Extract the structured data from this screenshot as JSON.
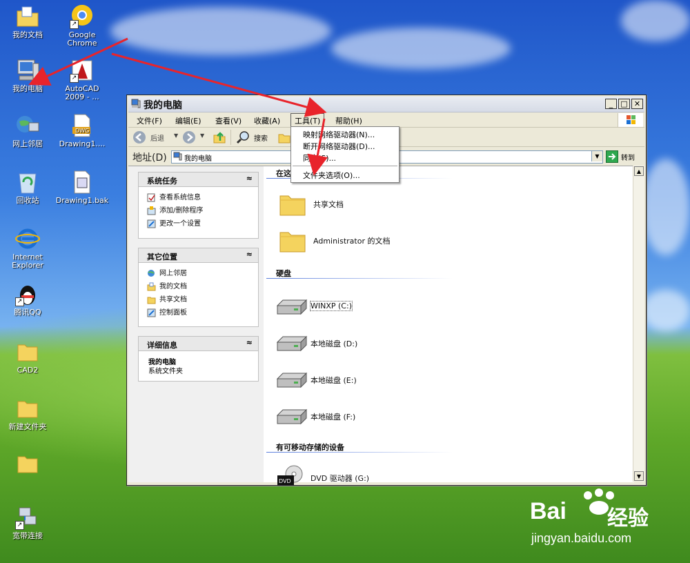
{
  "desktop": {
    "icons": [
      {
        "label": "我的文档"
      },
      {
        "label": "Google Chrome"
      },
      {
        "label": "我的电脑"
      },
      {
        "label": "AutoCAD 2009 - ..."
      },
      {
        "label": "网上邻居"
      },
      {
        "label": "Drawing1...."
      },
      {
        "label": "回收站"
      },
      {
        "label": "Drawing1.bak"
      },
      {
        "label": "Internet Explorer"
      },
      {
        "label": "腾讯QQ"
      },
      {
        "label": "CAD2"
      },
      {
        "label": "新建文件夹"
      },
      {
        "label": ""
      },
      {
        "label": "宽带连接"
      }
    ],
    "dwg_badge": "DWG"
  },
  "window": {
    "title": "我的电脑",
    "menus": [
      "文件(F)",
      "编辑(E)",
      "查看(V)",
      "收藏(A)",
      "工具(T)",
      "帮助(H)"
    ],
    "toolbar": {
      "back": "后退",
      "search": "搜索"
    },
    "address": {
      "label": "地址(D)",
      "value": "我的电脑",
      "go": "转到"
    },
    "tools_menu": {
      "items": [
        "映射网络驱动器(N)...",
        "断开网络驱动器(D)...",
        "同步(S)...",
        "文件夹选项(O)..."
      ]
    },
    "left_panels": [
      {
        "title": "系统任务",
        "links": [
          "查看系统信息",
          "添加/删除程序",
          "更改一个设置"
        ]
      },
      {
        "title": "其它位置",
        "links": [
          "网上邻居",
          "我的文档",
          "共享文档",
          "控制面板"
        ]
      },
      {
        "title": "详细信息",
        "detail_title": "我的电脑",
        "detail_sub": "系统文件夹"
      }
    ],
    "sections": {
      "files": "在这",
      "drives": "硬盘",
      "removable": "有可移动存储的设备"
    },
    "folders": [
      "共享文档",
      "Administrator 的文档"
    ],
    "drives": [
      "WINXP (C:)",
      "本地磁盘 (D:)",
      "本地磁盘 (E:)",
      "本地磁盘 (F:)"
    ],
    "removable": [
      "DVD 驱动器 (G:)"
    ]
  },
  "watermark": {
    "brand_a": "Bai",
    "brand_b": "经验",
    "url": "jingyan.baidu.com"
  },
  "colors": {
    "arrow": "#e8242b",
    "folder": "#f4d35e",
    "link_blue": "#1c4fb5"
  }
}
